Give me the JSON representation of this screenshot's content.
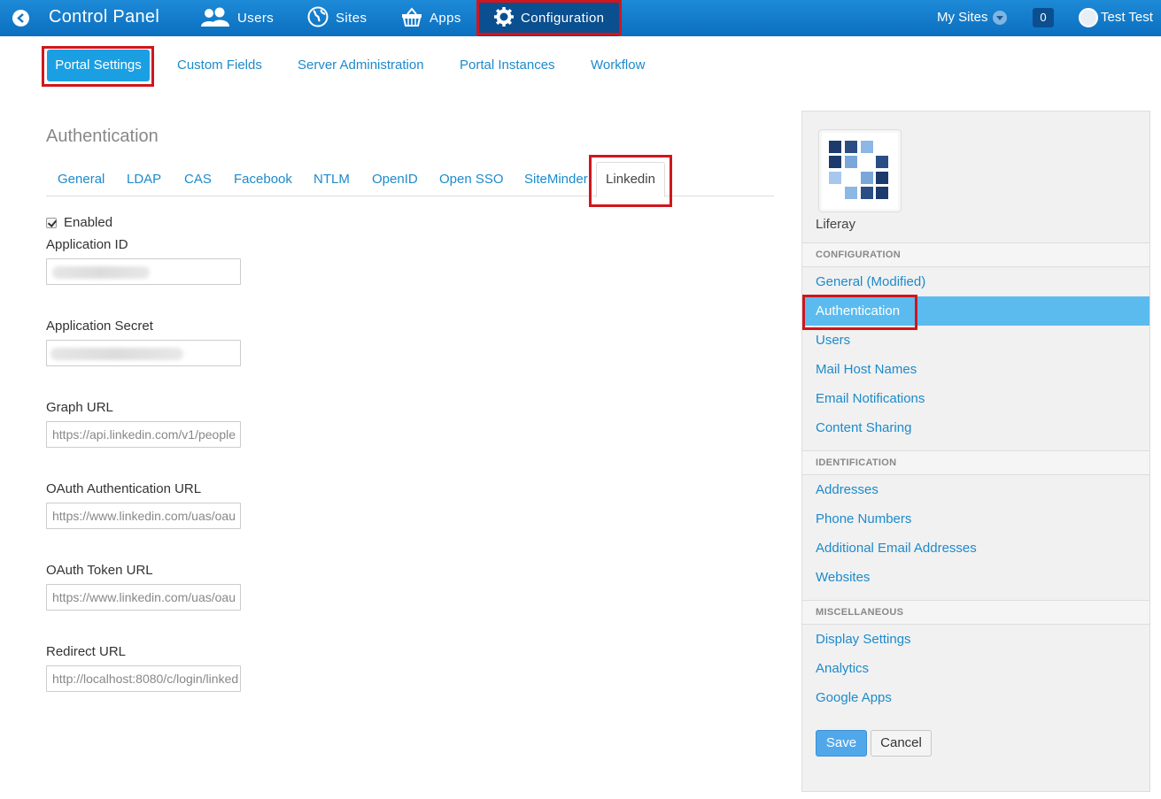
{
  "topbar": {
    "title": "Control Panel",
    "nav": [
      {
        "label": "Users",
        "icon": "users-icon"
      },
      {
        "label": "Sites",
        "icon": "globe-icon"
      },
      {
        "label": "Apps",
        "icon": "basket-icon"
      },
      {
        "label": "Configuration",
        "icon": "gear-icon"
      }
    ],
    "my_sites": "My Sites",
    "notifications": "0",
    "user": "Test Test"
  },
  "subnav": {
    "items": [
      "Portal Settings",
      "Custom Fields",
      "Server Administration",
      "Portal Instances",
      "Workflow"
    ]
  },
  "main": {
    "heading": "Authentication",
    "tabs": [
      "General",
      "LDAP",
      "CAS",
      "Facebook",
      "NTLM",
      "OpenID",
      "Open SSO",
      "SiteMinder",
      "Linkedin"
    ],
    "enabled_label": "Enabled",
    "fields": [
      {
        "label": "Application ID",
        "value": ""
      },
      {
        "label": "Application Secret",
        "value": ""
      },
      {
        "label": "Graph URL",
        "value": "https://api.linkedin.com/v1/people"
      },
      {
        "label": "OAuth Authentication URL",
        "value": "https://www.linkedin.com/uas/oau"
      },
      {
        "label": "OAuth Token URL",
        "value": "https://www.linkedin.com/uas/oau"
      },
      {
        "label": "Redirect URL",
        "value": "http://localhost:8080/c/login/linked"
      }
    ]
  },
  "panel": {
    "logo_name": "Liferay",
    "sections": [
      {
        "title": "CONFIGURATION",
        "items": [
          "General (Modified)",
          "Authentication",
          "Users",
          "Mail Host Names",
          "Email Notifications",
          "Content Sharing"
        ]
      },
      {
        "title": "IDENTIFICATION",
        "items": [
          "Addresses",
          "Phone Numbers",
          "Additional Email Addresses",
          "Websites"
        ]
      },
      {
        "title": "MISCELLANEOUS",
        "items": [
          "Display Settings",
          "Analytics",
          "Google Apps"
        ]
      }
    ],
    "save": "Save",
    "cancel": "Cancel"
  },
  "colors": {
    "topbar": "#1479c9",
    "link": "#1d8acb",
    "highlight": "#d0161d",
    "active_row": "#5bbbef"
  }
}
